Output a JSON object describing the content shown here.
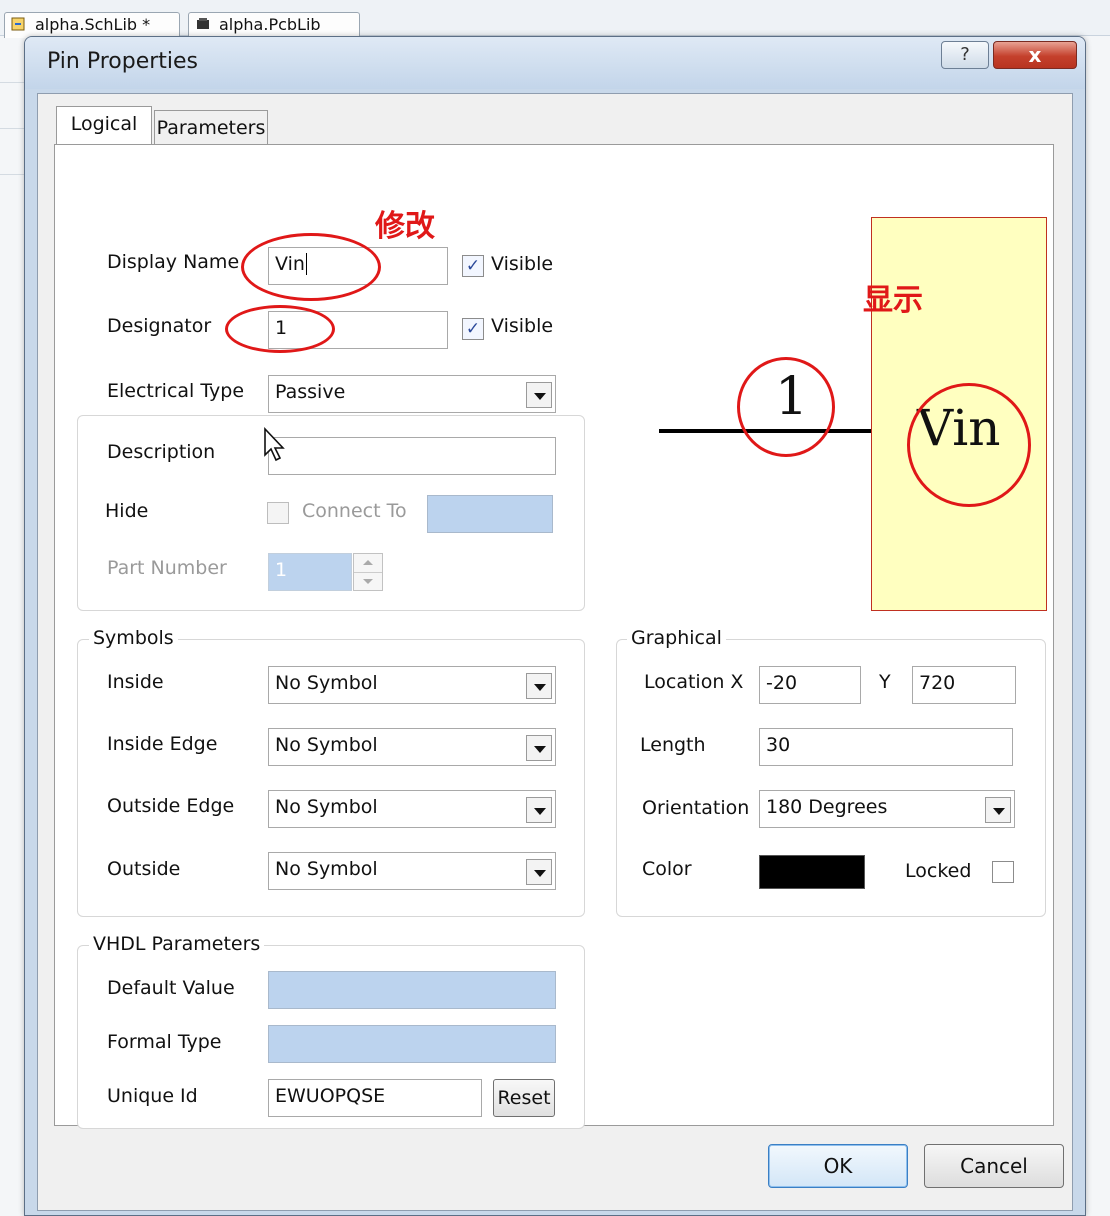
{
  "background_tabs": [
    {
      "label": "alpha.SchLib *"
    },
    {
      "label": "alpha.PcbLib"
    }
  ],
  "dialog": {
    "title": "Pin Properties",
    "help_label": "?",
    "close_label": "x"
  },
  "tabs": [
    {
      "label": "Logical",
      "active": true
    },
    {
      "label": "Parameters",
      "active": false
    }
  ],
  "logical": {
    "display_name": {
      "label": "Display Name",
      "value": "Vin",
      "visible_label": "Visible",
      "visible_checked": true
    },
    "designator": {
      "label": "Designator",
      "value": "1",
      "visible_label": "Visible",
      "visible_checked": true
    },
    "electrical_type": {
      "label": "Electrical Type",
      "value": "Passive"
    },
    "description": {
      "label": "Description",
      "value": ""
    },
    "hide": {
      "label": "Hide",
      "checked": false,
      "connect_to_label": "Connect To",
      "connect_to_value": ""
    },
    "part_number": {
      "label": "Part Number",
      "value": "1"
    }
  },
  "symbols": {
    "title": "Symbols",
    "inside": {
      "label": "Inside",
      "value": "No Symbol"
    },
    "inside_edge": {
      "label": "Inside Edge",
      "value": "No Symbol"
    },
    "outside_edge": {
      "label": "Outside Edge",
      "value": "No Symbol"
    },
    "outside": {
      "label": "Outside",
      "value": "No Symbol"
    }
  },
  "graphical": {
    "title": "Graphical",
    "location_label": "Location X",
    "x_value": "-20",
    "y_label": "Y",
    "y_value": "720",
    "length_label": "Length",
    "length_value": "30",
    "orientation_label": "Orientation",
    "orientation_value": "180 Degrees",
    "color_label": "Color",
    "color_value": "#000000",
    "locked_label": "Locked",
    "locked_checked": false
  },
  "vhdl": {
    "title": "VHDL Parameters",
    "default_value_label": "Default Value",
    "default_value": "",
    "formal_type_label": "Formal Type",
    "formal_type": "",
    "unique_id_label": "Unique Id",
    "unique_id": "EWUOPQSE",
    "reset_label": "Reset"
  },
  "preview": {
    "designator": "1",
    "name": "Vin",
    "body_color": "#ffffc0",
    "border_color": "#c03020"
  },
  "annotations": {
    "modify_text": "修改",
    "display_text": "显示",
    "color": "#e01818"
  },
  "footer": {
    "ok_label": "OK",
    "cancel_label": "Cancel"
  }
}
